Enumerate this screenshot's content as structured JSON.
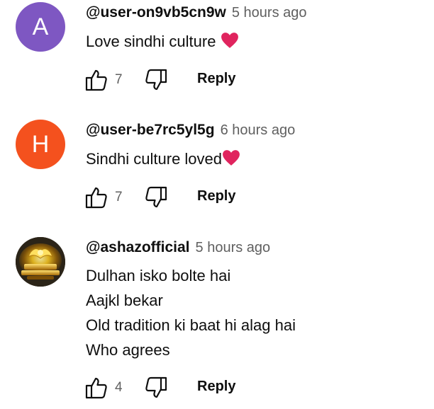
{
  "comments": [
    {
      "avatar_letter": "A",
      "avatar_color": "#7e57c2",
      "author": "@user-on9vb5cn9w",
      "time": "5 hours ago",
      "text": "Love sindhi culture ",
      "likes": "7",
      "reply_label": "Reply"
    },
    {
      "avatar_letter": "H",
      "avatar_color": "#f4511e",
      "author": "@user-be7rc5yl5g",
      "time": "6 hours ago",
      "text": "Sindhi culture loved",
      "likes": "7",
      "reply_label": "Reply"
    },
    {
      "avatar_image": "golden-logo-avatar",
      "author": "@ashazofficial",
      "time": "5 hours ago",
      "lines": [
        "Dulhan isko bolte hai",
        "Aajkl bekar",
        "Old tradition ki baat hi alag hai",
        "Who agrees"
      ],
      "likes": "4",
      "reply_label": "Reply"
    }
  ],
  "colors": {
    "heart": "#e0245e",
    "secondary_text": "#606060"
  }
}
